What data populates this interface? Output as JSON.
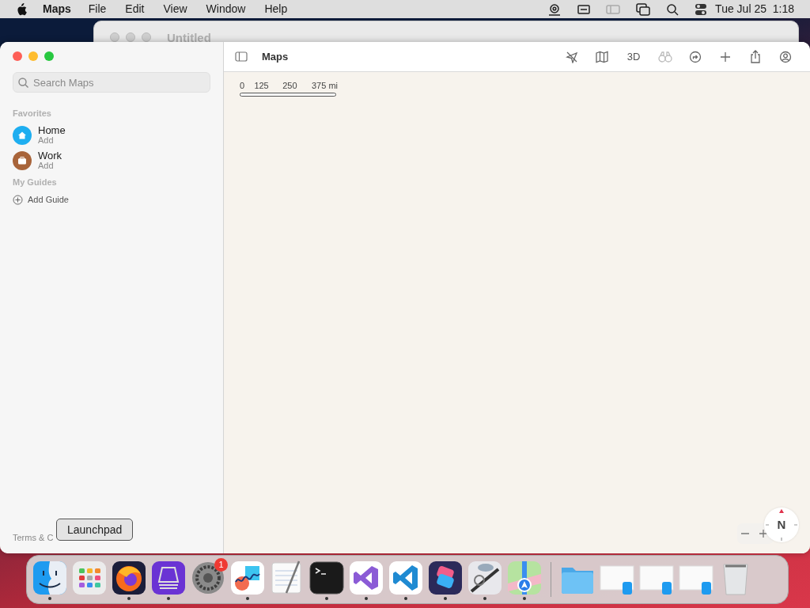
{
  "menu_bar": {
    "app": "Maps",
    "items": [
      "File",
      "Edit",
      "View",
      "Window",
      "Help"
    ],
    "clock": "Tue Jul 25  1:18"
  },
  "background_window": {
    "title": "Untitled"
  },
  "sidebar": {
    "search": {
      "placeholder": "Search Maps"
    },
    "sections": [
      {
        "title": "Favorites",
        "items": [
          {
            "kind": "home",
            "title": "Home",
            "subtitle": "Add",
            "color": "#1eaef0"
          },
          {
            "kind": "work",
            "title": "Work",
            "subtitle": "Add",
            "color": "#a8643a"
          }
        ]
      },
      {
        "title": "My Guides",
        "items": [
          {
            "kind": "add",
            "title": "Add Guide"
          }
        ]
      }
    ],
    "footer": "Terms & C"
  },
  "toolbar": {
    "title": "Maps",
    "view_button": "3D"
  },
  "map": {
    "scale_labels": [
      "0",
      "125",
      "250",
      "375 mi"
    ],
    "compass": "N"
  },
  "dock": {
    "tooltip": "Launchpad",
    "apps": [
      {
        "kind": "finder",
        "running": true
      },
      {
        "kind": "launchpad",
        "running": false
      },
      {
        "kind": "firefox",
        "running": true
      },
      {
        "kind": "configurator",
        "running": true
      },
      {
        "kind": "settings",
        "running": false,
        "badge": "1"
      },
      {
        "kind": "freeform",
        "running": true
      },
      {
        "kind": "textedit",
        "running": false
      },
      {
        "kind": "terminal",
        "running": true
      },
      {
        "kind": "visualstudio",
        "running": true
      },
      {
        "kind": "vscode",
        "running": true
      },
      {
        "kind": "shortcuts",
        "running": true
      },
      {
        "kind": "automator",
        "running": true
      },
      {
        "kind": "maps",
        "running": true
      }
    ],
    "others": [
      {
        "kind": "folder"
      },
      {
        "kind": "window"
      },
      {
        "kind": "window"
      },
      {
        "kind": "window"
      },
      {
        "kind": "trash"
      }
    ]
  }
}
